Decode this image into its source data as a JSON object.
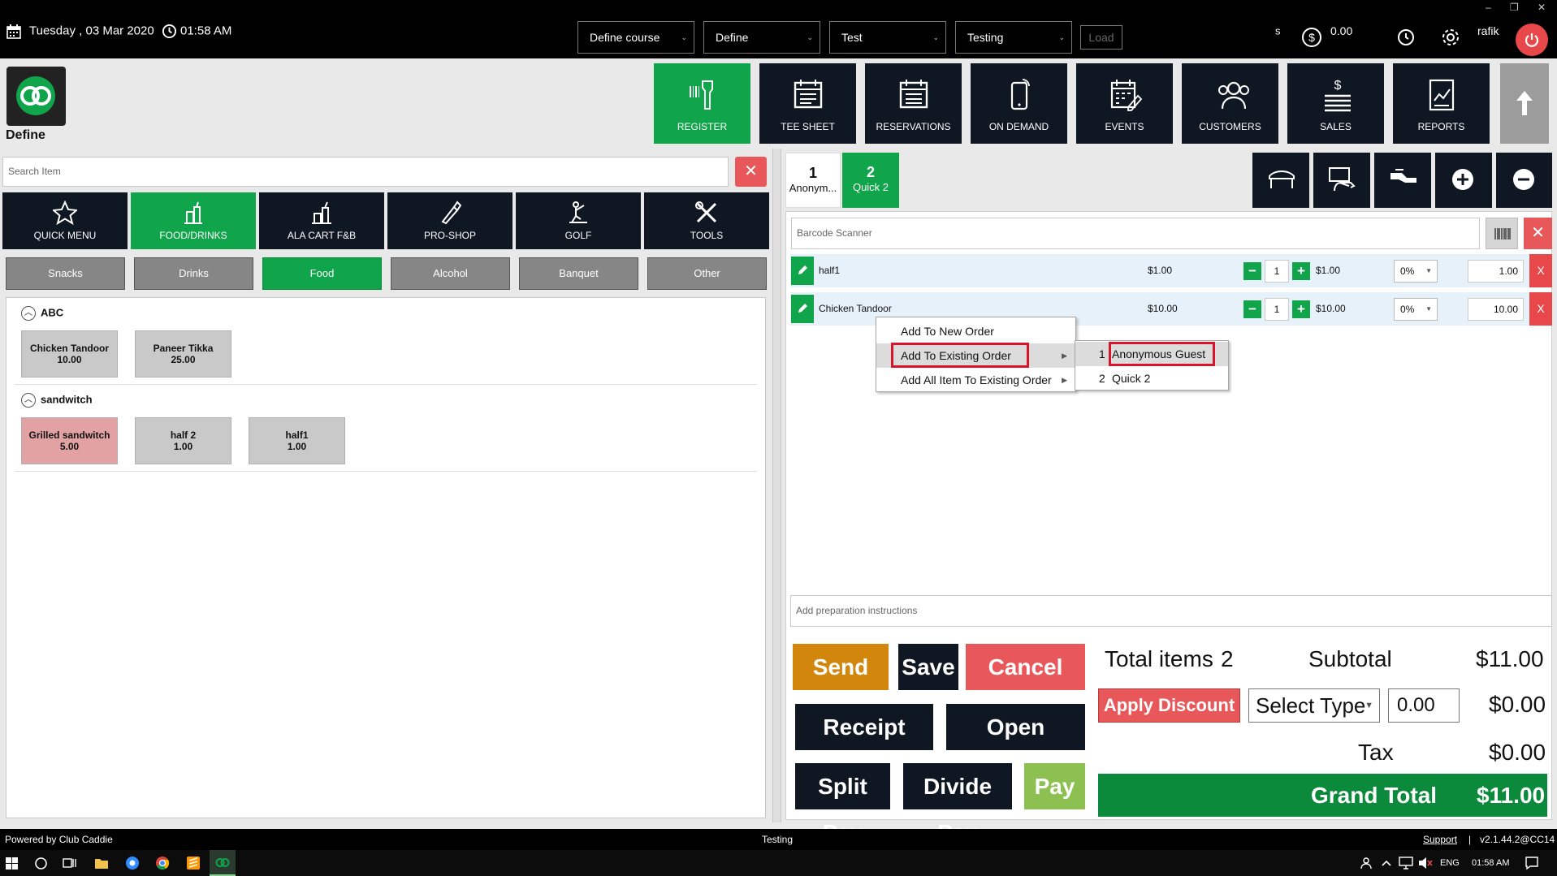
{
  "topbar": {
    "date": "Tuesday , 03 Mar 2020",
    "time": "01:58 AM",
    "dropdowns": [
      "Define course",
      "Define",
      "Test",
      "Testing"
    ],
    "load_label": "Load",
    "s_label": "s",
    "balance": "0.00",
    "user": "rafik",
    "window_controls": [
      "–",
      "❐",
      "✕"
    ]
  },
  "app": {
    "logo_label": "Define"
  },
  "nav": {
    "items": [
      {
        "label": "REGISTER",
        "icon": "barcode-scanner-icon",
        "active": true
      },
      {
        "label": "TEE SHEET",
        "icon": "calendar-icon"
      },
      {
        "label": "RESERVATIONS",
        "icon": "calendar-icon"
      },
      {
        "label": "ON DEMAND",
        "icon": "mobile-icon"
      },
      {
        "label": "EVENTS",
        "icon": "calendar-edit-icon"
      },
      {
        "label": "CUSTOMERS",
        "icon": "people-icon"
      },
      {
        "label": "SALES",
        "icon": "money-icon"
      },
      {
        "label": "REPORTS",
        "icon": "report-icon"
      }
    ]
  },
  "left": {
    "search_placeholder": "Search Item",
    "categories": [
      {
        "label": "QUICK MENU",
        "icon": "star-icon"
      },
      {
        "label": "FOOD/DRINKS",
        "icon": "drinks-icon",
        "active": true
      },
      {
        "label": "ALA CART F&B",
        "icon": "cart-drink-icon"
      },
      {
        "label": "PRO-SHOP",
        "icon": "golf-bag-icon"
      },
      {
        "label": "GOLF",
        "icon": "golfer-icon"
      },
      {
        "label": "TOOLS",
        "icon": "tools-icon"
      }
    ],
    "subcategories": [
      "Snacks",
      "Drinks",
      "Food",
      "Alcohol",
      "Banquet",
      "Other"
    ],
    "active_subcategory": "Food",
    "groups": [
      {
        "name": "ABC",
        "items": [
          {
            "name": "Chicken Tandoor",
            "price": "10.00"
          },
          {
            "name": "Paneer Tikka",
            "price": "25.00"
          }
        ]
      },
      {
        "name": "sandwitch",
        "items": [
          {
            "name": "Grilled sandwitch",
            "price": "5.00"
          },
          {
            "name": "half 2",
            "price": "1.00"
          },
          {
            "name": "half1",
            "price": "1.00"
          }
        ]
      }
    ]
  },
  "orders": {
    "tabs": [
      {
        "num": "1",
        "name": "Anonym..."
      },
      {
        "num": "2",
        "name": "Quick 2"
      }
    ],
    "barcode_placeholder": "Barcode Scanner",
    "lines": [
      {
        "name": "half1",
        "price": "$1.00",
        "qty": "1",
        "total": "$1.00",
        "discount": "0%",
        "amount": "1.00"
      },
      {
        "name": "Chicken Tandoor",
        "price": "$10.00",
        "qty": "1",
        "total": "$10.00",
        "discount": "0%",
        "amount": "10.00"
      }
    ],
    "prep_placeholder": "Add preparation instructions"
  },
  "context_menu": {
    "items": [
      "Add To New Order",
      "Add To Existing Order",
      "Add All Item To Existing Order"
    ],
    "submenu": [
      {
        "num": "1",
        "name": "Anonymous Guest"
      },
      {
        "num": "2",
        "name": "Quick 2"
      }
    ]
  },
  "actions": {
    "send": "Send",
    "save": "Save",
    "cancel": "Cancel",
    "receipt": "Receipt",
    "open": "Open",
    "split_pay": "Split Pay",
    "divide_pay": "Divide Pay",
    "pay": "Pay"
  },
  "summary": {
    "total_items_label": "Total items",
    "total_items": "2",
    "subtotal_label": "Subtotal",
    "subtotal": "$11.00",
    "apply_discount": "Apply Discount",
    "select_type": "Select Type",
    "discount_value": "0.00",
    "discount_amount": "$0.00",
    "tax_label": "Tax",
    "tax": "$0.00",
    "grand_total_label": "Grand Total",
    "grand_total": "$11.00"
  },
  "status": {
    "powered": "Powered by Club Caddie",
    "center": "Testing",
    "support": "Support",
    "sep": "|",
    "version": "v2.1.44.2@CC14"
  },
  "taskbar": {
    "lang": "ENG",
    "time": "01:58 AM"
  },
  "colors": {
    "green": "#10a44b",
    "dark": "#0f1722",
    "red": "#e8585a",
    "orange": "#d2860c",
    "light_green": "#8cc152"
  }
}
